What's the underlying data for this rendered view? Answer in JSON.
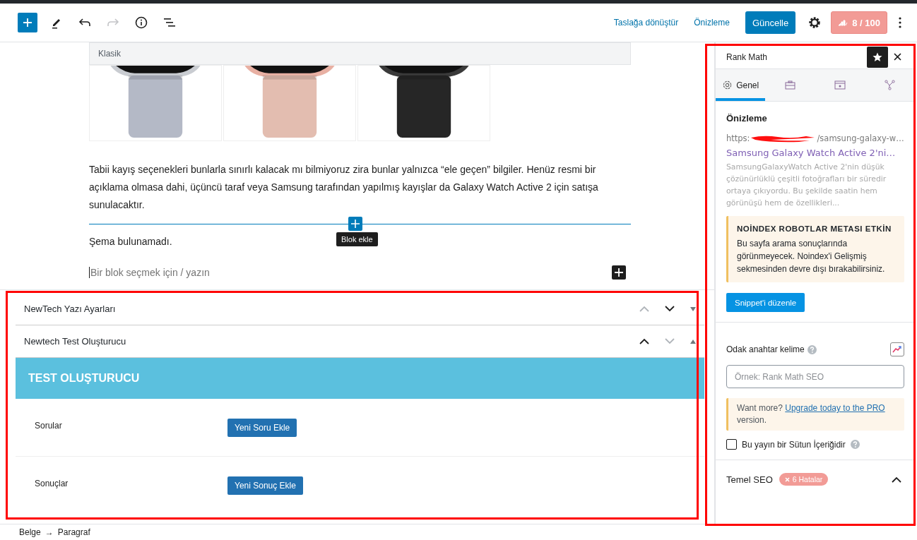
{
  "toolbar": [
    {
      "kind": "add",
      "disabled": false
    },
    {
      "kind": "edit",
      "disabled": false
    },
    {
      "kind": "undo",
      "disabled": false
    },
    {
      "kind": "redo",
      "disabled": true
    },
    {
      "kind": "info",
      "disabled": false
    },
    {
      "kind": "outline",
      "disabled": false
    }
  ],
  "actions": {
    "draft": "Taslağa dönüştür",
    "preview": "Önizleme",
    "update": "Güncelle",
    "score": "8 / 100"
  },
  "editor": {
    "block_label": "Klasik",
    "paragraph": "Tabii kayış seçenekleri bunlarla sınırlı kalacak mı bilmiyoruz zira bunlar yalnızca “ele geçen” bilgiler. Henüz resmi bir açıklama olmasa dahi, üçüncü taraf veya Samsung tarafından yapılmış kayışlar da Galaxy Watch Active 2 için satışa sunulacaktır.",
    "inserter_tooltip": "Blok ekle",
    "schema_note": "Şema bulunamadı.",
    "block_placeholder": "Bir blok seçmek için / yazın"
  },
  "meta_boxes": [
    {
      "title": "NewTech Yazı Ayarları",
      "expanded": false,
      "up_disabled": true,
      "down_disabled": false
    },
    {
      "title": "Newtech Test Oluşturucu",
      "expanded": true,
      "up_disabled": false,
      "down_disabled": true
    }
  ],
  "test_builder": {
    "title": "TEST OLUŞTURUCU",
    "rows": [
      {
        "label": "Sorular",
        "button": "Yeni Soru Ekle"
      },
      {
        "label": "Sonuçlar",
        "button": "Yeni Sonuç Ekle"
      }
    ]
  },
  "breadcrumb": {
    "items": [
      "Belge",
      "Paragraf"
    ],
    "separator": "→"
  },
  "sidebar": {
    "title": "Rank Math",
    "pinned": true,
    "tabs": [
      {
        "kind": "general",
        "label": "Genel",
        "selected": true
      },
      {
        "kind": "advanced",
        "selected": false
      },
      {
        "kind": "schema",
        "selected": false
      },
      {
        "kind": "social",
        "selected": false
      }
    ],
    "preview": {
      "heading": "Önizleme",
      "url_start": "https:",
      "url_end": "/samsung-galaxy-w…",
      "title": "Samsung Galaxy Watch Active 2'ni…",
      "description": "SamsungGalaxyWatch Active 2'nin düşük çözünürlüklü çeşitli fotoğrafları bir süredir ortaya çıkıyordu. Bu şekilde saatin hem görünüşü hem de özellikleri..."
    },
    "notice": {
      "title": "NOİNDEX ROBOTLAR METASI ETKİN",
      "text": "Bu sayfa arama sonuçlarında görünmeyecek. Noindex'i Gelişmiş sekmesinden devre dışı bırakabilirsiniz."
    },
    "edit_snippet": "Snippet'i düzenle",
    "focus_keyword": {
      "label": "Odak anahtar kelime",
      "placeholder": "Örnek: Rank Math SEO"
    },
    "upsell": {
      "text": "Want more?",
      "link": "Upgrade today to the PRO",
      "after": "version."
    },
    "pillar": {
      "label": "Bu yayın bir Sütun İçeriğidir",
      "checked": false
    },
    "basic_seo": {
      "title": "Temel SEO",
      "badge": "6 Hatalar",
      "expanded": true
    }
  }
}
